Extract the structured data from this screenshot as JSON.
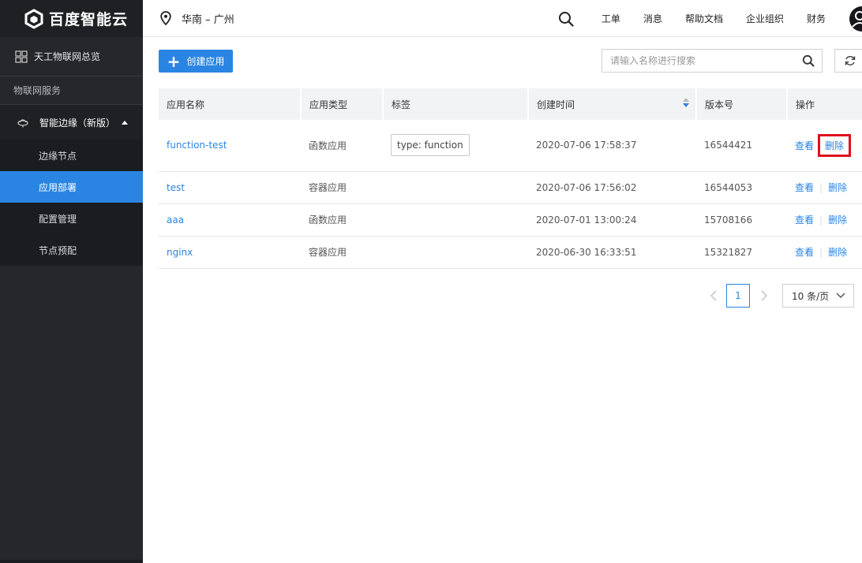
{
  "brand": {
    "name": "百度智能云"
  },
  "sidebar": {
    "overview": "天工物联网总览",
    "section": "物联网服务",
    "group": "智能边缘（新版）",
    "items": [
      {
        "label": "边缘节点",
        "active": false
      },
      {
        "label": "应用部署",
        "active": true
      },
      {
        "label": "配置管理",
        "active": false
      },
      {
        "label": "节点预配",
        "active": false
      }
    ]
  },
  "topbar": {
    "region": "华南 – 广州",
    "links": [
      "工单",
      "消息",
      "帮助文档",
      "企业组织",
      "财务"
    ]
  },
  "toolbar": {
    "create_label": "创建应用",
    "search_placeholder": "请输入名称进行搜索"
  },
  "table": {
    "headers": [
      "应用名称",
      "应用类型",
      "标签",
      "创建时间",
      "版本号",
      "操作"
    ],
    "rows": [
      {
        "name": "function-test",
        "type": "函数应用",
        "tag": "type: function",
        "created": "2020-07-06 17:58:37",
        "version": "16544421",
        "view": "查看",
        "delete": "删除"
      },
      {
        "name": "test",
        "type": "容器应用",
        "tag": "",
        "created": "2020-07-06 17:56:02",
        "version": "16544053",
        "view": "查看",
        "delete": "删除"
      },
      {
        "name": "aaa",
        "type": "函数应用",
        "tag": "",
        "created": "2020-07-01 13:00:24",
        "version": "15708166",
        "view": "查看",
        "delete": "删除"
      },
      {
        "name": "nginx",
        "type": "容器应用",
        "tag": "",
        "created": "2020-06-30 16:33:51",
        "version": "15321827",
        "view": "查看",
        "delete": "删除"
      }
    ]
  },
  "pagination": {
    "current_page": "1",
    "page_size": "10 条/页"
  },
  "colors": {
    "accent": "#2a85e2",
    "sidebar_bg": "#26272b",
    "highlight": "#e0121b"
  }
}
